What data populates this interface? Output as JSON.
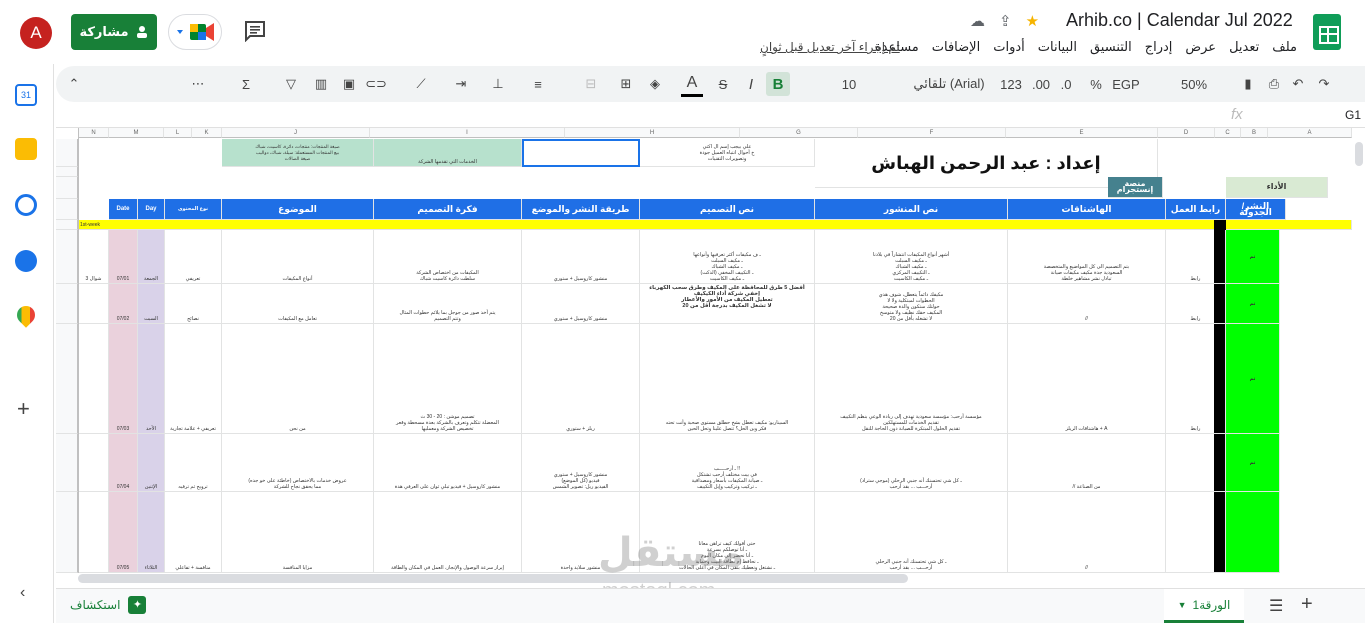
{
  "header": {
    "avatar_letter": "A",
    "share_label": "مشاركة",
    "doc_title": "Arhib.co | Calendar Jul 2022",
    "last_edit": "تم إجراء آخر تعديل قبل ثوانٍ",
    "menu": [
      "ملف",
      "تعديل",
      "عرض",
      "إدراج",
      "التنسيق",
      "البيانات",
      "أدوات",
      "الإضافات",
      "مساعدة"
    ]
  },
  "toolbar": {
    "zoom": "50%",
    "currency": "EGP",
    "percent": "%",
    "decimal_dec": ".0",
    "decimal_inc": ".00",
    "format_123": "123",
    "font": "تلقائي (Arial)",
    "font_size": "10",
    "bold": "B"
  },
  "formula_bar": {
    "cell_ref": "G1",
    "fx": "fx"
  },
  "columns": [
    "A",
    "B",
    "C",
    "D",
    "E",
    "F",
    "G",
    "H",
    "I",
    "J",
    "K",
    "L",
    "M",
    "N"
  ],
  "grid": {
    "title": "إعداد : عبد الرحمن الهباش",
    "performance": "الأداء",
    "platform": "منصة إنستجرام",
    "week": "1st-week",
    "f1_note": "الخدمات التي تقدمها الشركة",
    "e1_note": "صيغة المنتجات: منتجات، دائرة، كاسيت، شباك\nبيع المنتجات المستعملة: سيلة، شباك، دواليب\nصيغة الصالات",
    "h1_note": "علي بيجب إسم ال اكتي\nخ أحوال انتباه العميل جودة\nوتصويرات التقنيات",
    "headers": {
      "date": "Date",
      "day": "Day",
      "content_type": "نوع المحتوى",
      "topic": "الموضوع",
      "design_idea": "فكرة التصميم",
      "publish_method": "طريقة النشر والموضع",
      "design_text": "نص التصميم",
      "post_text": "نص المنشور",
      "hashtags": "الهاشتاقات",
      "work_link": "رابط العمل",
      "schedule": "النشر/الجدولة"
    },
    "row_nums": [
      "1",
      "2",
      "3",
      "4",
      "5",
      "6",
      "7",
      "8",
      "9",
      "10",
      "11"
    ],
    "rows": [
      {
        "date": "07/01",
        "day": "الجمعة",
        "type": "تعريفي",
        "topic": "أنواع المكيفات",
        "idea": "المكيفات من اختصاص الشركة\nسلطت دائرة كاسيت شباك",
        "method": "منشور كاروسيل + ستوري",
        "dtext": "ـ ف مكيفات أكثر تعرفيها وأنواعها\nـ مكيف السبلت\nـ مكيف الشباك\nـ التكييف المخفي (الدكت)\nـ مكيف الكاسيت",
        "ptext": "أشهر أنواع المكيفات انتشاراً في بلادنا\nـ مكيف السبلت\nـ مكيف الشباك\nـ التكييف المركزي\nـ مكيف الكاسيت",
        "hash": "بتم التصميم الى كل المواضيع والمتخصصة\nالسعودية جدة مكيف مكيفات صيانة\nتبادل نشر مشاهير خلطة",
        "link": "رابط",
        "sched": "تم",
        "k": "شوال 3"
      },
      {
        "date": "07/02",
        "day": "السبت",
        "type": "نصائح",
        "topic": "تعامل مع المكيفات",
        "idea": "يتم أخذ صور من جوجل بما يلائم حطوات المثال\nوتتم التصميم",
        "method": "منشور كاروسيل + ستوري",
        "dtext": "أفضل 5 طرق للمحافظة على المكيف وطرق سحب الكهرباء\nإخفي شركة أداء الكيكيف\nتعطيل المكيف من الأمور والأعطار\nلا تشغل المكيف بدرجة أقل من 20",
        "ptext": "مكيفك دائماً يتعطل، شوف هذي\nالحطوات لمبتكلية ولا لا\nحولتك ستكون والدة صحيحة\nالمكيف حقك نظيف ولا متوسخ\nلا تشغله بأقل من 20",
        "hash": "//",
        "link": "رابط",
        "sched": "تم",
        "k": ""
      },
      {
        "date": "07/03",
        "day": "الأحد",
        "type": "تعريفي + علامة تجارية",
        "topic": "من نحن",
        "idea": "تصميم موشن : 20 - 30 ث\nالمعضلة تتكلم وتعرف بالشركة بعدة مسحطة وقعر\nتخصيص الشركة ومعمليها",
        "method": "ريلز + ستوري",
        "dtext": "السيناريو: مكيف تعطل بشخ حطلق مستوى صحبة وأنت تحته\nفكر وين الحل؟ تتصل علينا وتحل الحين",
        "ptext": "مؤسسة أرحب: مؤسسة سعودية تهدف إلى ربادة الوعي بنظم التكييف\nتقديم الخدمات للمستهلكين\nتقديم الحلول المبتكرة للصيانة دون الحاجة للنقل",
        "hash": "هاشتاقات الريلز + A",
        "link": "رابط",
        "sched": "تم",
        "k": ""
      },
      {
        "date": "07/04",
        "day": "الإثنين",
        "type": "ترويج ثم ترفيه",
        "topic": "عروض خدمات بالاختصاص (خاطئة على خو جده)\nمما يحقق نجاح للشركة",
        "idea": "منشور كاروسيل + فيديو تبلي ثوان على العرفي هدة",
        "method": "منشور كاروسيل + ستوري\nفيديو (كل الموضع)\nالفيديو ريل: تصوير الشمس",
        "dtext": "ـ أرحـــــب !!\nفي بيت مختلف أرحب تشتكل\nـ صيانة المكيفات بأسعار ومصداقية\nـ تركيب وتركيب وإيل التكييف",
        "ptext": "ـ كل شي تحتسنك أنه جنبي الرحلي (موجي ستراد)\nأرحـــب ... بقد أرحب",
        "hash": "// من الصناعة",
        "link": "",
        "sched": "تم",
        "k": ""
      },
      {
        "date": "07/05",
        "day": "الثلاثاء",
        "type": "منافسة + تفاعلي",
        "topic": "مزايا المنافسة",
        "idea": "إبراز سرعة الوصول والإنجاز، العمل في المكان والطاقة",
        "method": "منشور سلايد واحدة",
        "dtext": "حتى أقولك كيف تراهن معانا\nـ أنا توصلكم بسرعة\nـ أنا نحضر إلى مكان اليوم\nـ نحافظ إم نظافة البيت وحماية\nـ نشتغل ونعطيك بتقى المكان في أعلى الحالات",
        "ptext": "ـ كل شي تحتسنك أنه جنبي الرحلي\nأرحـــب ... بقد أرحب",
        "hash": "//",
        "link": "",
        "sched": "",
        "k": ""
      }
    ]
  },
  "bottom": {
    "explore": "استكشاف",
    "sheet_tab": "الورقة1"
  },
  "watermark": {
    "text": "مستقل",
    "sub": "mostaql.com"
  }
}
